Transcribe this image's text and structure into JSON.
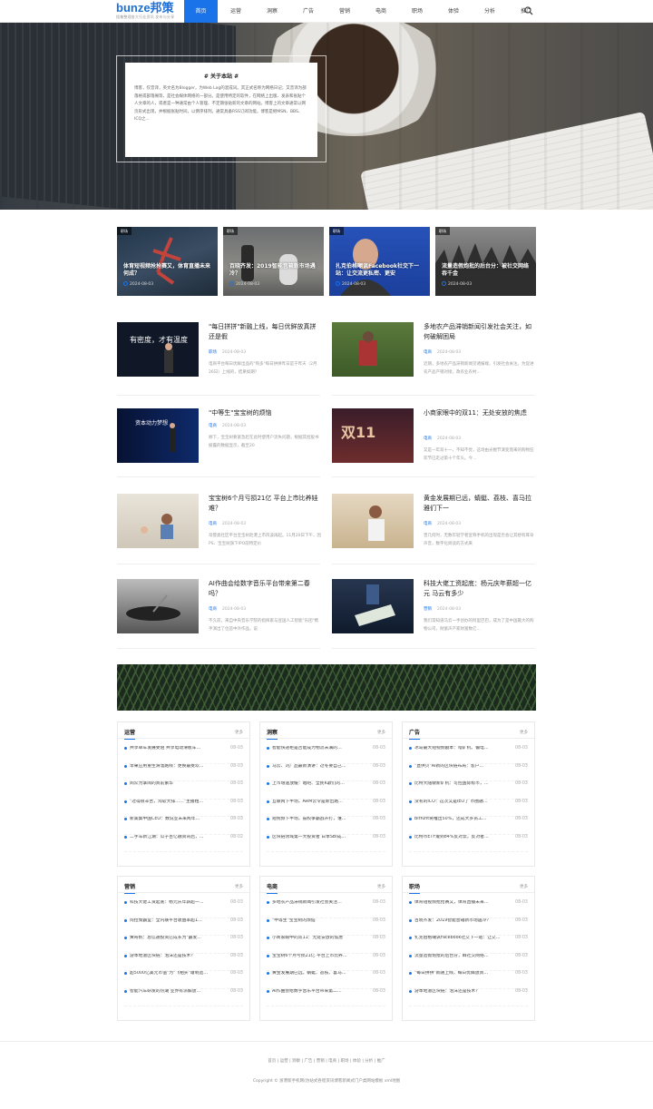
{
  "logo": {
    "text": "bunze邦策",
    "slogan": "搜集整理各大行业资讯 发布与分享"
  },
  "nav": {
    "items": [
      "首页",
      "运营",
      "洞察",
      "广告",
      "营销",
      "电商",
      "职场",
      "体验",
      "分析",
      "推广"
    ],
    "active": 0
  },
  "about": {
    "title": "# 关于本站 #",
    "text": "博客，仅音译，英文名为Blogger，为Web Log的混成词。其正式名称为网络日记；又音译为部落格或部落阁等，是社会媒体网络的一部分。是使用特定的软件，在网络上出版、发表和张贴个人文章的人，或者是一种通常由个人管理、不定期张贴新的文章的网站。博客上的文章通常以网页形式出现，并根据张贴时间，以倒序排列。通常具备RSS订阅功能。博客是继MSN、BBS、ICQ之..."
  },
  "featured": [
    {
      "tag": "职场",
      "title": "体育短视频抢抢赛又，体育直播未来何成？",
      "date": "2024-08-03"
    },
    {
      "tag": "职场",
      "title": "百晓齐发：2019智能音箱新市场遇冷？",
      "date": "2024-08-03"
    },
    {
      "tag": "职场",
      "title": "扎克伯格嘲讽Facebook社交下一站：让交流更私密、更安",
      "date": "2024-08-03"
    },
    {
      "tag": "职场",
      "title": "流量造假炮批的后台分：被社交网络吞千金",
      "date": "2024-08-03"
    }
  ],
  "articles": [
    {
      "title": "\"每日拼拼\"新融上线，每日优鲜放真拼还是假",
      "cat": "职场",
      "date": "2024-08-03",
      "excerpt": "电商平台每日优鲜出品的\"购多\"每日拼拼昨日是于昨天（2月26日）上线的，结果如期？"
    },
    {
      "title": "多地农产品滞销新闻引发社会关注，如何破解困局",
      "cat": "电商",
      "date": "2024-08-03",
      "excerpt": "近期，多地农产品滞销新闻见诸报端，引发社会关注。为促进农产品产销对接，政农业农村…"
    },
    {
      "title": "\"中等生\"宝宝树的烦恼",
      "cat": "电商",
      "date": "2024-08-03",
      "excerpt": "顾下，宝宝树要紧急赶在此时使用户流失问题，根据其招股书披露的数据显示，截至20"
    },
    {
      "title": "小商家眼中的双11：无处安放的焦虑",
      "cat": "电商",
      "date": "2024-08-03",
      "excerpt": "又是一年双十一，不知不觉，这场由光棍节演变而来的购物狂欢节已走过第十个年头。今…"
    },
    {
      "title": "宝宝树6个月亏损21亿 平台上市比养娃难？",
      "cat": "电商",
      "date": "2024-08-03",
      "excerpt": "母婴类社区平台宝宝树赴港上市风波再起。11月20日下午，因PS、宝宝树旗下IPO前特定价"
    },
    {
      "title": "黄金发展期已远，蜻蜓、荔枝、喜马拉雅们下一",
      "cat": "电商",
      "date": "2024-08-03",
      "excerpt": "曾几何时，无数年轻学者宣称手机的出现是否会让其想有耳朵声音，数字化阅读的方式来"
    },
    {
      "title": "AI作曲会给数字音乐平台带来第二春吗？",
      "cat": "电商",
      "date": "2024-08-03",
      "excerpt": "不久前，来自中央音乐学院的指挥家与宣国人工智能\"乐团\"携手演出了位首中外作品，说"
    },
    {
      "title": "科技大佬工资起底：杨元庆年薪超一亿元 马云有多少",
      "cat": "营销",
      "date": "2024-08-03",
      "excerpt": "我们常知道马云一手创办的阿里巴巴，成为了是中国最大的购物公司，财富声产家财富数亿…"
    }
  ],
  "boxes": [
    {
      "title": "运营",
      "more": "更多",
      "items": [
        "共享单车发展受阻 共享电动滑板车…",
        "苹果应用重生滑溜路线：更换最受欢…",
        "阅众为掌阅的真前繁华",
        "\"过得很辛苦，淘软大排……\"主播粗…",
        "新美集中国CEO：数说业未来两年…",
        "二手车新江湖：瓜子百亿融资背后，…"
      ],
      "dates": [
        "08-03",
        "08-03",
        "08-03",
        "08-03",
        "08-03",
        "08-02"
      ]
    },
    {
      "title": "洞察",
      "more": "更多",
      "items": [
        "智能快递柜是否能成为物流未满的…",
        "马云、刘广品最新演讲：过冬要自己…",
        "上市增速放缓：唱吧、全民K歌们的…",
        "互联网下半场，ARM云令是新出路…",
        "短视频下半场，鼓权争霸战开打，谁…",
        "区块链领域第一大投资者 日本SBI成…"
      ],
      "dates": [
        "08-03",
        "08-03",
        "08-03",
        "08-03",
        "08-03",
        "08-03"
      ]
    },
    {
      "title": "广告",
      "more": "更多",
      "items": [
        "冰岛最大短视频剧本：啥矿机、偏电…",
        "\"直供贝\"AI新的区块链布局：客户…",
        "比特大陆敏新矿机：可控国际标币，…",
        "没有的ICO：这次又是IEO了 币圈融…",
        "Bitfunt将推出50%，还成大多员工…",
        "比特币ETF遭到84%反对票，反对者…"
      ],
      "dates": [
        "08-03",
        "08-03",
        "08-03",
        "08-03",
        "08-03",
        "08-03"
      ]
    },
    {
      "title": "营销",
      "more": "更多",
      "items": [
        "科技大佬工资起底：杨元庆年薪超一…",
        "阿拉策霸室：全内联平台收益率超1…",
        "黄奇帆：总信通投资已成长为\"霸发…",
        "游本地滋区块链：泡沫还是技术？",
        "超5000亿美元市值\"为\"飞相买\"遭制造…",
        "智能汽车研发的热潮 业界有派解放…"
      ],
      "dates": [
        "08-03",
        "08-03",
        "08-03",
        "08-03",
        "08-03",
        "08-03"
      ]
    },
    {
      "title": "电商",
      "more": "更多",
      "items": [
        "多地农产品滞销新闻引发社会关注…",
        "\"中等生\"宝宝树的烦恼",
        "小商家眼中的双11：无处安放的焦虑",
        "宝宝树6个月亏损21亿 平台上市比养…",
        "黄金发展期已远，蜻蜓、荔枝、喜马…",
        "AI作曲会给数字音乐平台带来第二…"
      ],
      "dates": [
        "08-03",
        "08-03",
        "08-03",
        "08-03",
        "08-03",
        "08-03"
      ]
    },
    {
      "title": "职场",
      "more": "更多",
      "items": [
        "体育短视频抢抢赛又，体育直播未来…",
        "百晓齐发：2019智能音箱新市场遇冷？",
        "扎克伯格嘲讽Facebook社交下一站：让交…",
        "流量造假炮批的后台分，鲜社交网络…",
        "\"每日拼拼\"新融上线，每日优鲜放真…",
        "游本地滋区块链：泡沫还是技术？"
      ],
      "dates": [
        "08-03",
        "08-03",
        "08-03",
        "08-03",
        "08-03",
        "08-03"
      ]
    }
  ],
  "footer": {
    "links": "首页 | 运营 | 洞察 | 广告 | 营销 | 电商 | 职场 | 体验 | 分析 | 推广",
    "copyright": "Copyright © 浙港新手机网(仿站式各程资讯博客新闻式门户类网站模板     xml地图"
  },
  "colors": {
    "accent": "#1a73e8"
  }
}
